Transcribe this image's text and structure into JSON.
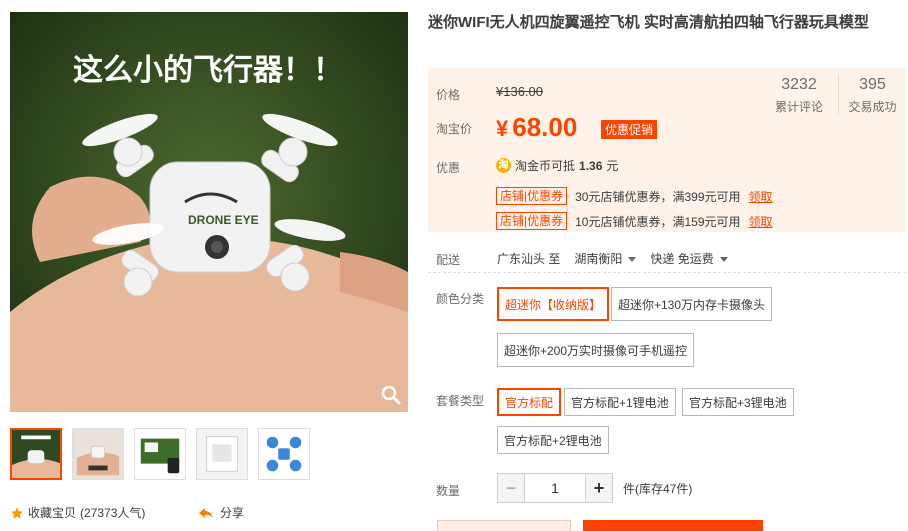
{
  "product": {
    "title": "迷你WIFI无人机四旋翼遥控飞机 实时高清航拍四轴飞行器玩具模型",
    "image_caption": "这么小的飞行器！！",
    "drone_brand": "DRONE EYE"
  },
  "price": {
    "label": "价格",
    "original": "¥136.00",
    "taobao_label": "淘宝价",
    "yen": "¥",
    "current": "68.00",
    "promo_tag": "优惠促销",
    "reviews_count": "3232",
    "reviews_label": "累计评论",
    "deals_count": "395",
    "deals_label": "交易成功"
  },
  "discount": {
    "label": "优惠",
    "coin_icon": "淘",
    "coin_text_prefix": "淘金币可抵",
    "coin_amount": "1.36",
    "coin_text_suffix": "元",
    "coupons": [
      {
        "tag": "店铺|优惠券",
        "text": "30元店铺优惠券，满399元可用",
        "link": "领取"
      },
      {
        "tag": "店铺|优惠券",
        "text": "10元店铺优惠券，满159元可用",
        "link": "领取"
      }
    ]
  },
  "shipping": {
    "label": "配送",
    "from": "广东汕头 至",
    "to": "湖南衡阳",
    "method": "快递 免运费"
  },
  "color": {
    "label": "颜色分类",
    "options": [
      "超迷你【收纳版】",
      "超迷你+130万内存卡摄像头",
      "超迷你+200万实时摄像可手机遥控"
    ],
    "selected": 0
  },
  "package": {
    "label": "套餐类型",
    "options": [
      "官方标配",
      "官方标配+1锂电池",
      "官方标配+3锂电池",
      "官方标配+2锂电池"
    ],
    "selected": 0
  },
  "quantity": {
    "label": "数量",
    "value": "1",
    "minus": "−",
    "plus": "+",
    "stock": "件(库存47件)"
  },
  "gallery": {
    "favorite_label": "收藏宝贝",
    "favorite_count": "(27373人气)",
    "share_label": "分享"
  },
  "colors": {
    "accent": "#ff4400",
    "price_bg": "#fff2e8"
  }
}
